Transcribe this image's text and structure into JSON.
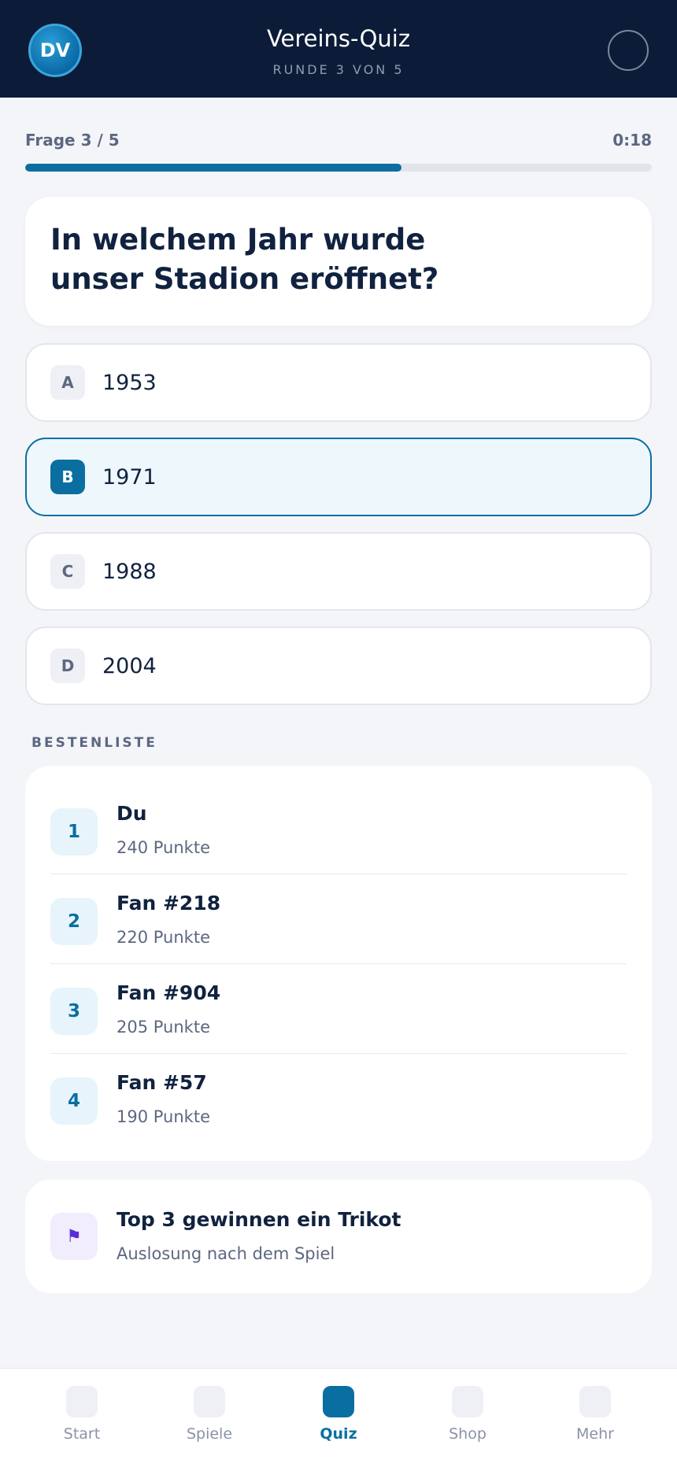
{
  "header": {
    "avatar_initials": "DV",
    "title": "Vereins-Quiz",
    "subtitle": "RUNDE 3 VON 5"
  },
  "progress": {
    "question_label": "Frage 3 / 5",
    "timer": "0:18",
    "fraction": 0.6
  },
  "question": {
    "text": "In welchem Jahr wurde unser Stadion eröffnet?"
  },
  "answers": [
    {
      "letter": "A",
      "text": "1953",
      "selected": false
    },
    {
      "letter": "B",
      "text": "1971",
      "selected": true
    },
    {
      "letter": "C",
      "text": "1988",
      "selected": false
    },
    {
      "letter": "D",
      "text": "2004",
      "selected": false
    }
  ],
  "leaderboard": {
    "title": "BESTENLISTE",
    "rows": [
      {
        "rank": "1",
        "name": "Du",
        "points": "240 Punkte"
      },
      {
        "rank": "2",
        "name": "Fan #218",
        "points": "220 Punkte"
      },
      {
        "rank": "3",
        "name": "Fan #904",
        "points": "205 Punkte"
      },
      {
        "rank": "4",
        "name": "Fan #57",
        "points": "190 Punkte"
      }
    ]
  },
  "prize": {
    "icon": "flag-icon",
    "icon_glyph": "⚑",
    "title": "Top 3 gewinnen ein Trikot",
    "subtitle": "Auslosung nach dem Spiel"
  },
  "nav": {
    "items": [
      {
        "label": "Start",
        "active": false
      },
      {
        "label": "Spiele",
        "active": false
      },
      {
        "label": "Quiz",
        "active": true
      },
      {
        "label": "Shop",
        "active": false
      },
      {
        "label": "Mehr",
        "active": false
      }
    ]
  },
  "colors": {
    "header_bg": "#0c1c38",
    "accent": "#0a6fa0",
    "page_bg": "#f4f5f9",
    "prize_icon": "#5b2bd6"
  }
}
